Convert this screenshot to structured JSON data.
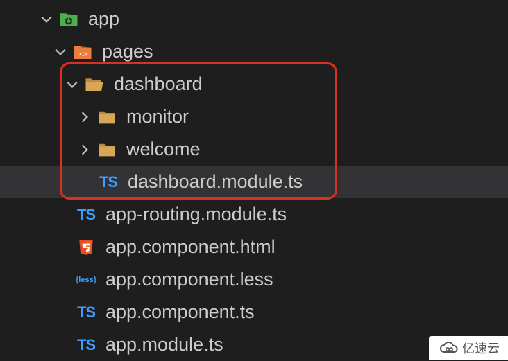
{
  "tree": {
    "app": {
      "label": "app",
      "pages": {
        "label": "pages",
        "dashboard": {
          "label": "dashboard",
          "monitor": {
            "label": "monitor"
          },
          "welcome": {
            "label": "welcome"
          },
          "module_file": {
            "label": "dashboard.module.ts"
          }
        }
      },
      "files": {
        "routing": {
          "label": "app-routing.module.ts"
        },
        "html": {
          "label": "app.component.html"
        },
        "less": {
          "label": "app.component.less"
        },
        "component_ts": {
          "label": "app.component.ts"
        },
        "module_ts": {
          "label": "app.module.ts"
        }
      }
    }
  },
  "watermark": {
    "text": "亿速云"
  }
}
